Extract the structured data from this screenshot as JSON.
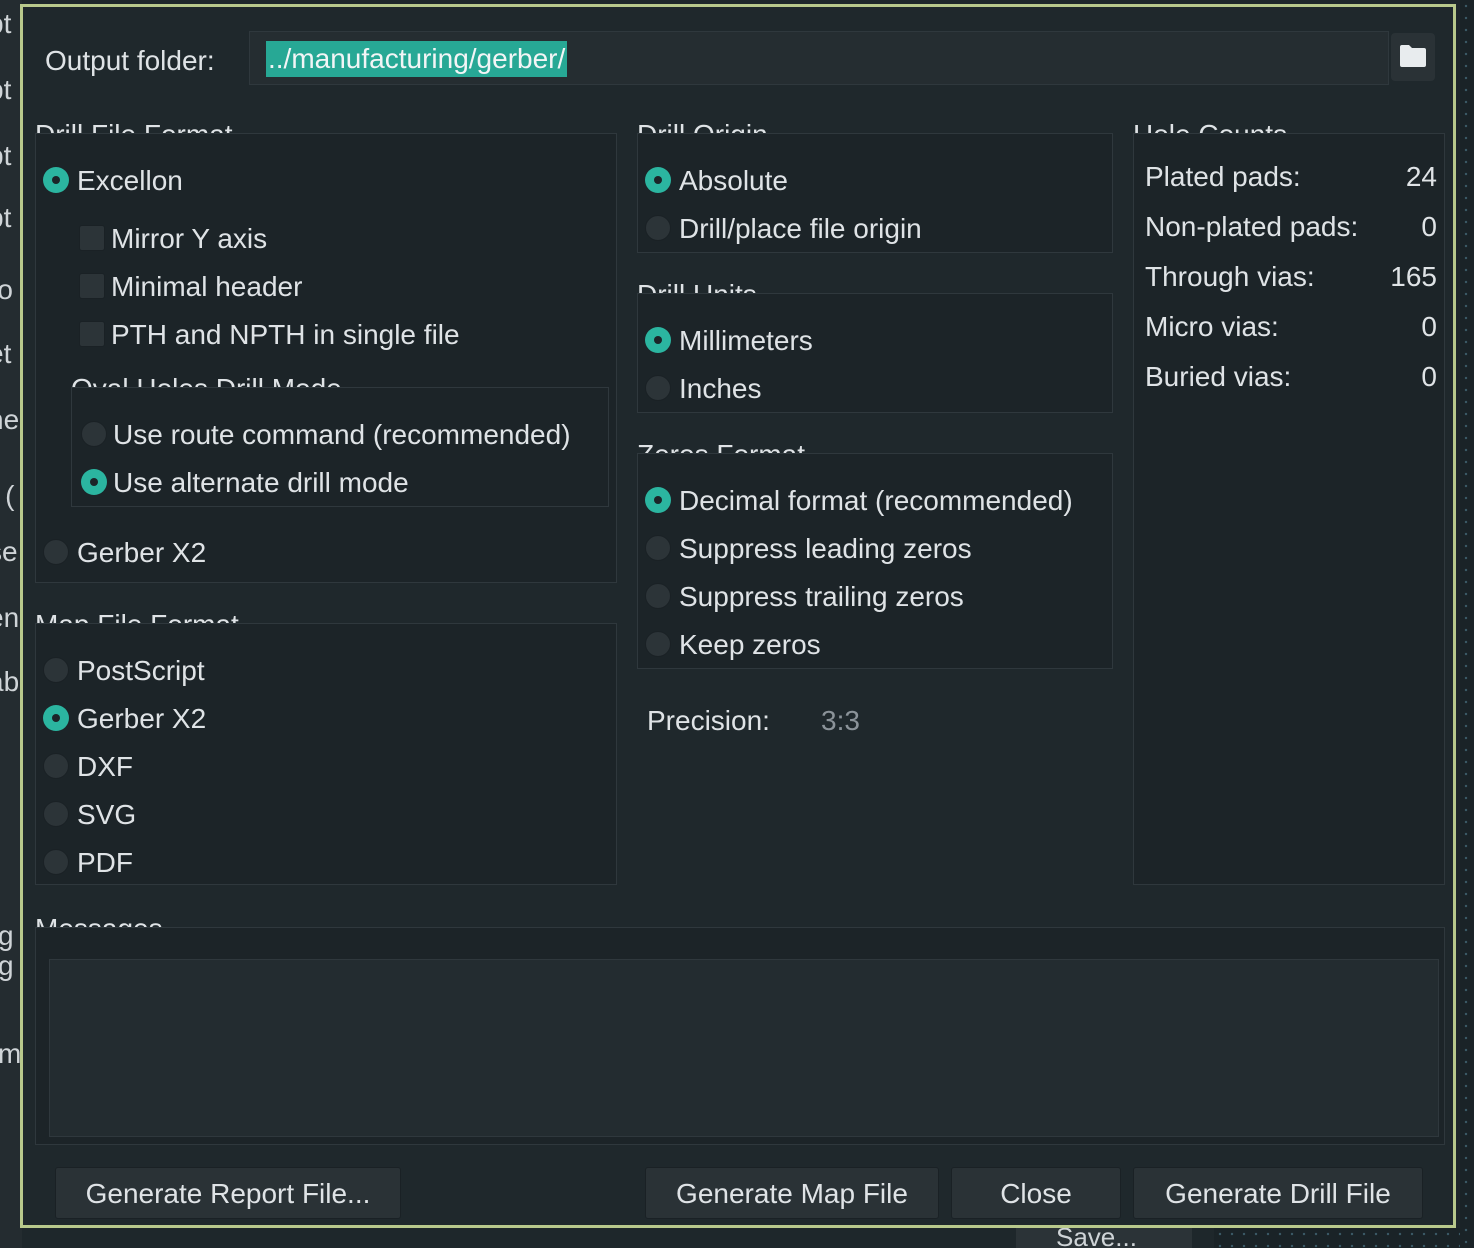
{
  "background": {
    "left_fragments": [
      "pt",
      "pt",
      "pt",
      "pt",
      "ro",
      "et",
      "ne",
      "r (",
      "se",
      "en",
      "ab",
      "g",
      "g",
      "m"
    ],
    "bottom_button": "Save..."
  },
  "output": {
    "label": "Output folder:",
    "value": "../manufacturing/gerber/",
    "browse_icon": "folder-icon"
  },
  "drill_file_format": {
    "title": "Drill File Format",
    "excellon": "Excellon",
    "mirror_y": "Mirror Y axis",
    "minimal_header": "Minimal header",
    "single_file": "PTH and NPTH in single file",
    "oval_title": "Oval Holes Drill Mode",
    "use_route": "Use route command (recommended)",
    "use_alternate": "Use alternate drill mode",
    "gerber_x2": "Gerber X2"
  },
  "map_file_format": {
    "title": "Map File Format",
    "options": [
      "PostScript",
      "Gerber X2",
      "DXF",
      "SVG",
      "PDF"
    ],
    "selected": "Gerber X2"
  },
  "drill_origin": {
    "title": "Drill Origin",
    "options": [
      "Absolute",
      "Drill/place file origin"
    ],
    "selected": "Absolute"
  },
  "drill_units": {
    "title": "Drill Units",
    "options": [
      "Millimeters",
      "Inches"
    ],
    "selected": "Millimeters"
  },
  "zeros_format": {
    "title": "Zeros Format",
    "options": [
      "Decimal format (recommended)",
      "Suppress leading zeros",
      "Suppress trailing zeros",
      "Keep zeros"
    ],
    "selected": "Decimal format (recommended)"
  },
  "precision": {
    "label": "Precision:",
    "value": "3:3"
  },
  "hole_counts": {
    "title": "Hole Counts",
    "rows": [
      {
        "label": "Plated pads:",
        "value": "24"
      },
      {
        "label": "Non-plated pads:",
        "value": "0"
      },
      {
        "label": "Through vias:",
        "value": "165"
      },
      {
        "label": "Micro vias:",
        "value": "0"
      },
      {
        "label": "Buried vias:",
        "value": "0"
      }
    ]
  },
  "messages": {
    "title": "Messages"
  },
  "buttons": {
    "report": "Generate Report File...",
    "map": "Generate Map File",
    "close": "Close",
    "drill": "Generate Drill File"
  },
  "colors": {
    "accent": "#2bb5a0",
    "border": "#b8c98c",
    "background": "#1f282c"
  }
}
